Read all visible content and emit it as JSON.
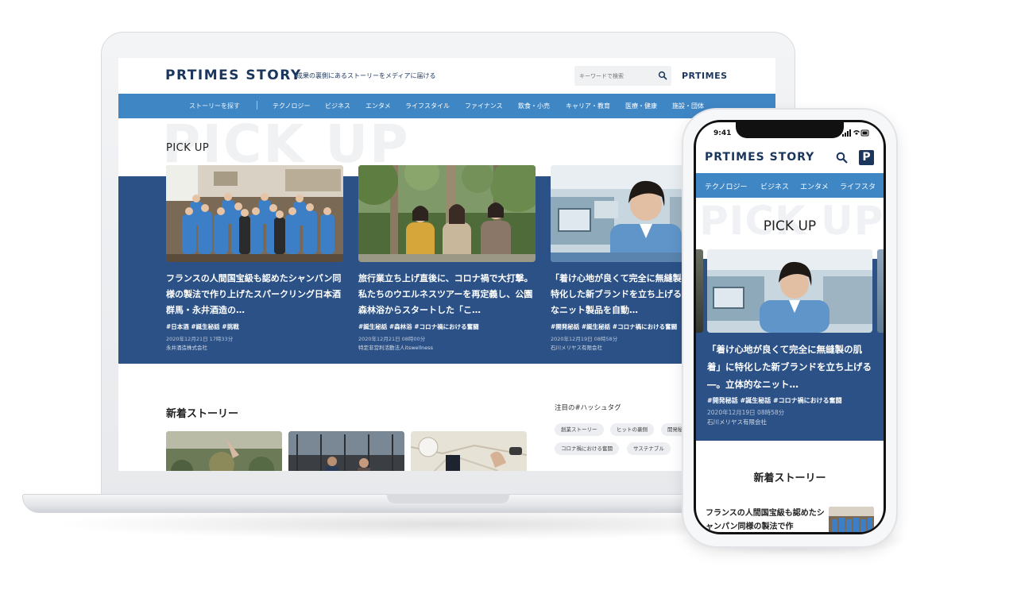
{
  "desktop": {
    "logo": "PRTIMES STORY",
    "tagline": "成果の裏側にあるストーリーをメディアに届ける",
    "search_placeholder": "キーワードで検索",
    "prtimes_link": "PRTIMES",
    "nav": [
      "ストーリーを探す",
      "テクノロジー",
      "ビジネス",
      "エンタメ",
      "ライフスタイル",
      "ファイナンス",
      "飲食・小売",
      "キャリア・教育",
      "医療・健康",
      "施設・団体"
    ],
    "pickup_bg": "PICK UP",
    "pickup_title": "PICK UP",
    "cards": [
      {
        "title": "フランスの人間国宝級も認めたシャンパン同様の製法で作り上げたスパークリング日本酒 群馬・永井酒造の…",
        "tags": "#日本酒 #誕生秘話 #挑戦",
        "date": "2020年12月21日 17時33分",
        "company": "永井酒造株式会社"
      },
      {
        "title": "旅行業立ち上げ直後に、コロナ禍で大打撃。私たちのウエルネスツアーを再定義し、公園森林浴からスタートした「こ…",
        "tags": "#誕生秘話 #森林浴 #コロナ禍における奮闘",
        "date": "2020年12月21日 08時00分",
        "company": "特定非営利活動法人itswellness"
      },
      {
        "title": "「着け心地が良くて完全に無縫製の肌着」に特化した新ブランドを立ち上げる―。立体的なニット製品を自動…",
        "tags": "#開発秘話 #誕生秘話 #コロナ禍における奮闘",
        "date": "2020年12月19日 08時58分",
        "company": "石川メリヤス有限会社"
      }
    ],
    "new_stories_title": "新着ストーリー",
    "hashtag_title": "注目の#ハッシュタグ",
    "hashtags": [
      "創業ストーリー",
      "ヒットの裏側",
      "開発秘話",
      "コロナ禍における奮闘",
      "サステナブル"
    ]
  },
  "mobile": {
    "time": "9:41",
    "logo": "PRTIMES STORY",
    "p_icon": "P",
    "nav": [
      "テクノロジー",
      "ビジネス",
      "エンタメ",
      "ライフスタ"
    ],
    "pickup_bg": "PICK UP",
    "pickup_title": "PICK UP",
    "card": {
      "title": "「着け心地が良くて完全に無縫製の肌着」に特化した新ブランドを立ち上げる―。立体的なニット…",
      "tags": "#開発秘話 #誕生秘話 #コロナ禍における奮闘",
      "date": "2020年12月19日 08時58分",
      "company": "石川メリヤス有限会社"
    },
    "new_stories_title": "新着ストーリー",
    "new_story_row": "フランスの人間国宝級も認めたシャンパン同様の製法で作"
  },
  "colors": {
    "brand_navy": "#1b365d",
    "nav_blue": "#3f86c5",
    "band_blue": "#2b5186"
  }
}
